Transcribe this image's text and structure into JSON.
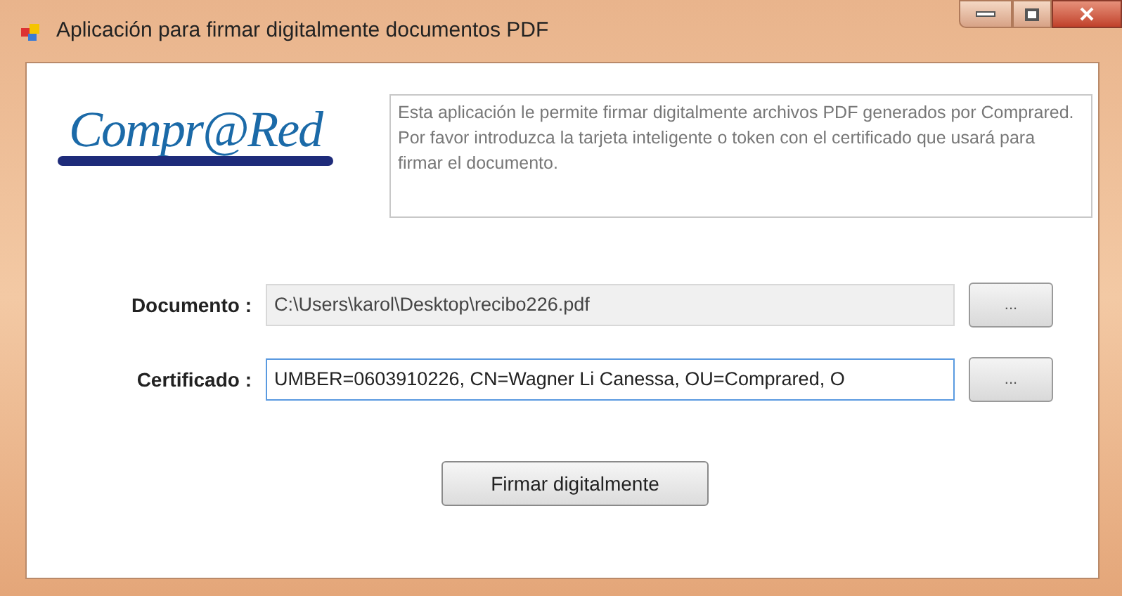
{
  "window": {
    "title": "Aplicación para firmar digitalmente documentos PDF"
  },
  "logo": {
    "text": "Compr@Red"
  },
  "info": {
    "lines": [
      "Esta aplicación le permite firmar digitalmente archivos PDF generados por Comprared.",
      "Por favor introduzca la tarjeta inteligente o token con el certificado que usará para firmar el documento."
    ]
  },
  "fields": [
    {
      "label": "Documento :",
      "value": "C:\\Users\\karol\\Desktop\\recibo226.pdf",
      "disabled": true,
      "focused": false,
      "button": "..."
    },
    {
      "label": "Certificado :",
      "value": "UMBER=0603910226, CN=Wagner Li Canessa, OU=Comprared, O",
      "disabled": false,
      "focused": true,
      "button": "..."
    }
  ],
  "submit": {
    "label": "Firmar digitalmente"
  }
}
